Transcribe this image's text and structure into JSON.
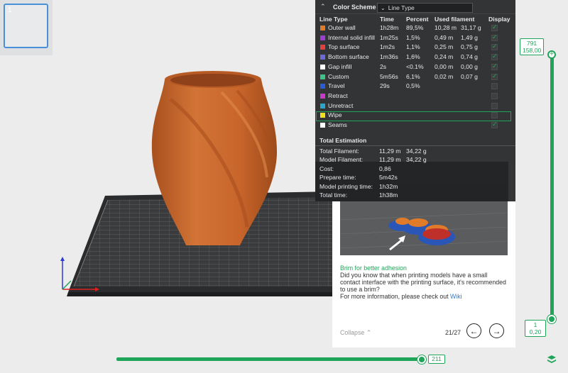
{
  "thumbnail": {
    "number": "1"
  },
  "legend": {
    "title": "Color Scheme",
    "select_value": "Line Type",
    "headers": {
      "line_type": "Line Type",
      "time": "Time",
      "percent": "Percent",
      "used_filament": "Used filament",
      "display": "Display"
    },
    "rows": [
      {
        "name": "Outer wall",
        "time": "1h28m",
        "percent": "89,5%",
        "length": "10,28 m",
        "weight": "31,17 g",
        "color": "#e07b2a",
        "checked": true
      },
      {
        "name": "Internal solid infill",
        "time": "1m25s",
        "percent": "1,5%",
        "length": "0,49 m",
        "weight": "1,49 g",
        "color": "#9a3fd0",
        "checked": true
      },
      {
        "name": "Top surface",
        "time": "1m2s",
        "percent": "1,1%",
        "length": "0,25 m",
        "weight": "0,75 g",
        "color": "#e04040",
        "checked": true
      },
      {
        "name": "Bottom surface",
        "time": "1m36s",
        "percent": "1,6%",
        "length": "0,24 m",
        "weight": "0,74 g",
        "color": "#6b6ad6",
        "checked": true
      },
      {
        "name": "Gap infill",
        "time": "2s",
        "percent": "<0.1%",
        "length": "0,00 m",
        "weight": "0,00 g",
        "color": "#ffffff",
        "checked": true
      },
      {
        "name": "Custom",
        "time": "5m56s",
        "percent": "6,1%",
        "length": "0,02 m",
        "weight": "0,07 g",
        "color": "#3ec28a",
        "checked": true
      },
      {
        "name": "Travel",
        "time": "29s",
        "percent": "0,5%",
        "length": "",
        "weight": "",
        "color": "#2c5bd6",
        "checked": false
      },
      {
        "name": "Retract",
        "time": "",
        "percent": "",
        "length": "",
        "weight": "",
        "color": "#c83ac8",
        "checked": false
      },
      {
        "name": "Unretract",
        "time": "",
        "percent": "",
        "length": "",
        "weight": "",
        "color": "#2aa6c8",
        "checked": false
      },
      {
        "name": "Wipe",
        "time": "",
        "percent": "",
        "length": "",
        "weight": "",
        "color": "#f0e020",
        "checked": false
      },
      {
        "name": "Seams",
        "time": "",
        "percent": "",
        "length": "",
        "weight": "",
        "color": "#ffffff",
        "checked": true
      }
    ],
    "total_title": "Total Estimation",
    "totals": [
      {
        "label": "Total Filament:",
        "value": "11,29 m",
        "value2": "34,22 g"
      },
      {
        "label": "Model Filament:",
        "value": "11,29 m",
        "value2": "34,22 g"
      },
      {
        "label": "Cost:",
        "value": "0,86",
        "value2": ""
      },
      {
        "label": "Prepare time:",
        "value": "5m42s",
        "value2": ""
      },
      {
        "label": "Model printing time:",
        "value": "1h32m",
        "value2": ""
      },
      {
        "label": "Total time:",
        "value": "1h38m",
        "value2": ""
      }
    ]
  },
  "tip": {
    "title": "Brim for better adhesion",
    "body": "Did you know that when printing models have a small contact interface with the printing surface, it's recommended to use a brim?",
    "more_prefix": "For more information, please check out ",
    "link": "Wiki",
    "collapse": "Collapse",
    "page": "21/27"
  },
  "vslider": {
    "top_layer": "791",
    "top_height": "158,00",
    "bottom_layer": "1",
    "bottom_height": "0,20"
  },
  "hslider": {
    "value": "211"
  },
  "colors": {
    "accent": "#1fa55a",
    "vase": "#c8642a"
  }
}
